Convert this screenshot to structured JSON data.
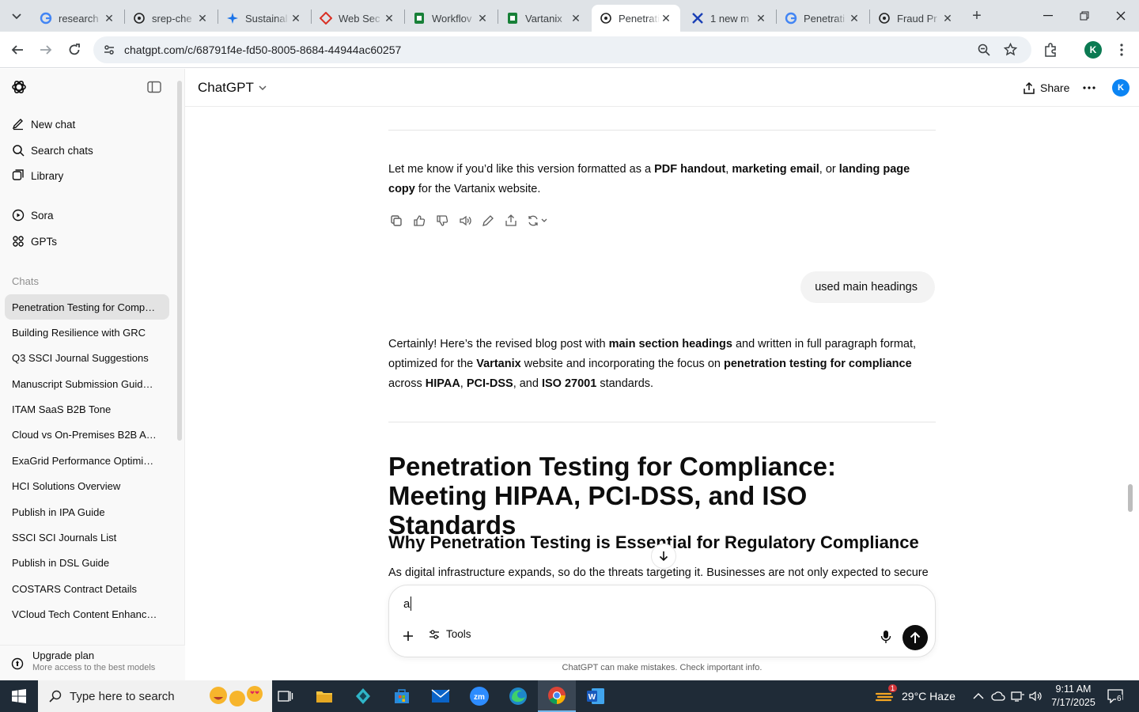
{
  "browser": {
    "tabs": [
      {
        "title": "research"
      },
      {
        "title": "srep-che"
      },
      {
        "title": "Sustainal"
      },
      {
        "title": "Web Sec"
      },
      {
        "title": "Workflov"
      },
      {
        "title": "Vartanix"
      },
      {
        "title": "Penetrati",
        "active": true
      },
      {
        "title": "1 new m"
      },
      {
        "title": "Penetrati"
      },
      {
        "title": "Fraud Pr"
      }
    ],
    "url": "chatgpt.com/c/68791f4e-fd50-8005-8684-44944ac60257",
    "profile_initial": "K"
  },
  "sidebar": {
    "nav": [
      {
        "label": "New chat",
        "icon": "new-chat-icon"
      },
      {
        "label": "Search chats",
        "icon": "search-icon"
      },
      {
        "label": "Library",
        "icon": "library-icon"
      }
    ],
    "nav2": [
      {
        "label": "Sora",
        "icon": "sora-icon"
      },
      {
        "label": "GPTs",
        "icon": "gpts-icon"
      }
    ],
    "chats_heading": "Chats",
    "chats": [
      "Penetration Testing for Compli...",
      "Building Resilience with GRC",
      "Q3 SSCI Journal Suggestions",
      "Manuscript Submission Guideli...",
      "ITAM SaaS B2B Tone",
      "Cloud vs On-Premises B2B Ana...",
      "ExaGrid Performance Optimizat...",
      "HCI Solutions Overview",
      "Publish in IPA Guide",
      "SSCI SCI Journals List",
      "Publish in DSL Guide",
      "COSTARS Contract Details",
      "VCloud Tech Content Enhance..."
    ],
    "upgrade_title": "Upgrade plan",
    "upgrade_sub": "More access to the best models"
  },
  "header": {
    "model": "ChatGPT",
    "share": "Share",
    "avatar": "K"
  },
  "conversation": {
    "p1_a": "Let me know if you’d like this version formatted as a ",
    "p1_b1": "PDF handout",
    "p1_c": ", ",
    "p1_b2": "marketing email",
    "p1_d": ", or ",
    "p1_b3": "landing page copy",
    "p1_e": " for the Vartanix website.",
    "user_msg": "used main headings",
    "p2_a": "Certainly! Here’s the revised blog post with ",
    "p2_b1": "main section headings",
    "p2_c": " and written in full paragraph format, optimized for the ",
    "p2_b2": "Vartanix",
    "p2_d": " website and incorporating the focus on ",
    "p2_b3": "penetration testing for compliance",
    "p2_e": " across ",
    "p2_b4": "HIPAA",
    "p2_f": ", ",
    "p2_b5": "PCI-DSS",
    "p2_g": ", and ",
    "p2_b6": "ISO 27001",
    "p2_h": " standards.",
    "h1": "Penetration Testing for Compliance: Meeting HIPAA, PCI-DSS, and ISO Standards",
    "h2": "Why Penetration Testing is Essential for Regulatory Compliance",
    "p3": "As digital infrastructure expands, so do the threats targeting it. Businesses are not only expected to secure"
  },
  "composer": {
    "value": "a",
    "tools_label": "Tools"
  },
  "disclaimer": "ChatGPT can make mistakes. Check important info.",
  "taskbar": {
    "search_placeholder": "Type here to search",
    "weather": "29°C  Haze",
    "time": "9:11 AM",
    "date": "7/17/2025",
    "notif_count": "6",
    "weather_badge": "1"
  }
}
